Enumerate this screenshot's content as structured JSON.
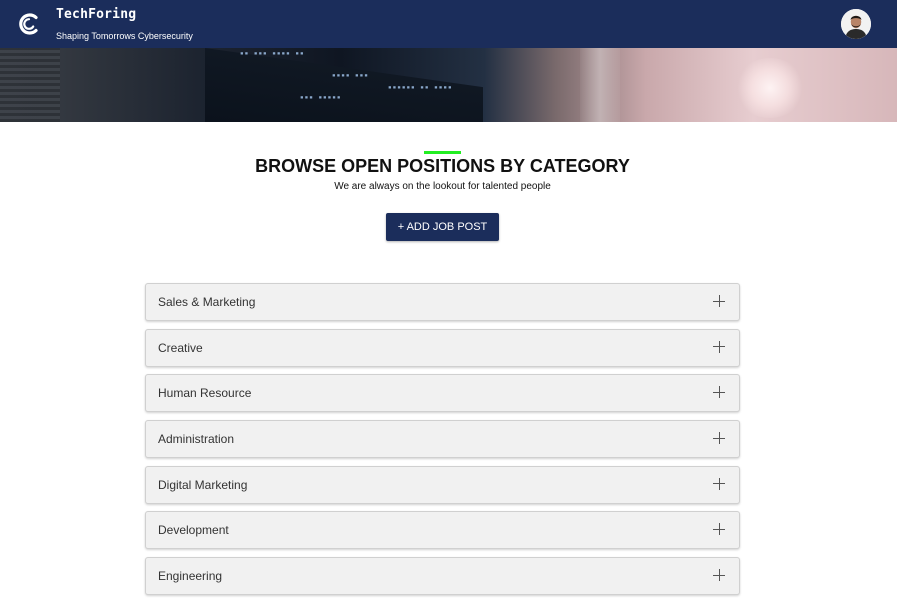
{
  "header": {
    "brand_name": "TechForing",
    "tagline": "Shaping Tomorrows Cybersecurity"
  },
  "main": {
    "title": "BROWSE OPEN POSITIONS BY CATEGORY",
    "subtitle": "We are always on the lookout for talented people",
    "add_button_label": "+ ADD JOB POST"
  },
  "categories": [
    {
      "label": "Sales & Marketing",
      "icon": "plus-icon"
    },
    {
      "label": "Creative",
      "icon": "plus-icon"
    },
    {
      "label": "Human Resource",
      "icon": "plus-icon"
    },
    {
      "label": "Administration",
      "icon": "plus-icon"
    },
    {
      "label": "Digital Marketing",
      "icon": "plus-icon"
    },
    {
      "label": "Development",
      "icon": "plus-icon"
    },
    {
      "label": "Engineering",
      "icon": "plus-icon"
    }
  ],
  "colors": {
    "header_bg": "#1b2d5b",
    "accent": "#22ee22",
    "button_bg": "#1b2d5b",
    "accordion_bg": "#f1f1f1"
  }
}
